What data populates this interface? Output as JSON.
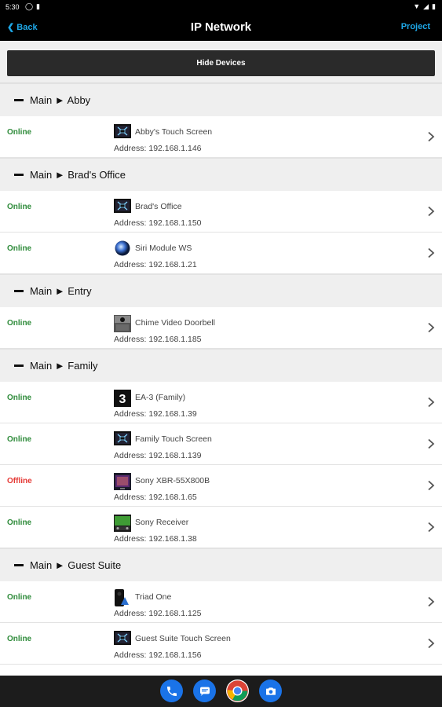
{
  "status_bar": {
    "time": "5:30"
  },
  "header": {
    "back_label": "Back",
    "title": "IP Network",
    "project_label": "Project"
  },
  "toolbar": {
    "hide_devices_label": "Hide Devices"
  },
  "sections": [
    {
      "title": "Main ► Abby",
      "devices": [
        {
          "status": "Online",
          "online": true,
          "icon": "touch-screen-icon",
          "name": "Abby's Touch Screen",
          "address": "Address: 192.168.1.146"
        }
      ]
    },
    {
      "title": "Main ► Brad's Office",
      "devices": [
        {
          "status": "Online",
          "online": true,
          "icon": "touch-screen-icon",
          "name": "Brad's Office",
          "address": "Address: 192.168.1.150"
        },
        {
          "status": "Online",
          "online": true,
          "icon": "siri-orb-icon",
          "name": "Siri Module WS",
          "address": "Address: 192.168.1.21"
        }
      ]
    },
    {
      "title": "Main ► Entry",
      "devices": [
        {
          "status": "Online",
          "online": true,
          "icon": "doorbell-icon",
          "name": "Chime Video Doorbell",
          "address": "Address: 192.168.1.185"
        }
      ]
    },
    {
      "title": "Main ► Family",
      "devices": [
        {
          "status": "Online",
          "online": true,
          "icon": "ea3-controller-icon",
          "name": "EA-3 (Family)",
          "address": "Address: 192.168.1.39"
        },
        {
          "status": "Online",
          "online": true,
          "icon": "touch-screen-icon",
          "name": "Family Touch Screen",
          "address": "Address: 192.168.1.139"
        },
        {
          "status": "Offline",
          "online": false,
          "icon": "tv-icon",
          "name": "Sony XBR-55X800B",
          "address": "Address: 192.168.1.65"
        },
        {
          "status": "Online",
          "online": true,
          "icon": "receiver-icon",
          "name": "Sony Receiver",
          "address": "Address: 192.168.1.38"
        }
      ]
    },
    {
      "title": "Main ► Guest Suite",
      "devices": [
        {
          "status": "Online",
          "online": true,
          "icon": "triad-speaker-icon",
          "name": "Triad One",
          "address": "Address: 192.168.1.125"
        },
        {
          "status": "Online",
          "online": true,
          "icon": "touch-screen-icon",
          "name": "Guest Suite Touch Screen",
          "address": "Address: 192.168.1.156"
        }
      ]
    }
  ],
  "dock": [
    "phone-icon",
    "messages-icon",
    "chrome-icon",
    "camera-icon"
  ],
  "colors": {
    "online": "#2e8b3a",
    "offline": "#e53935",
    "accent": "#1ea8e8"
  }
}
